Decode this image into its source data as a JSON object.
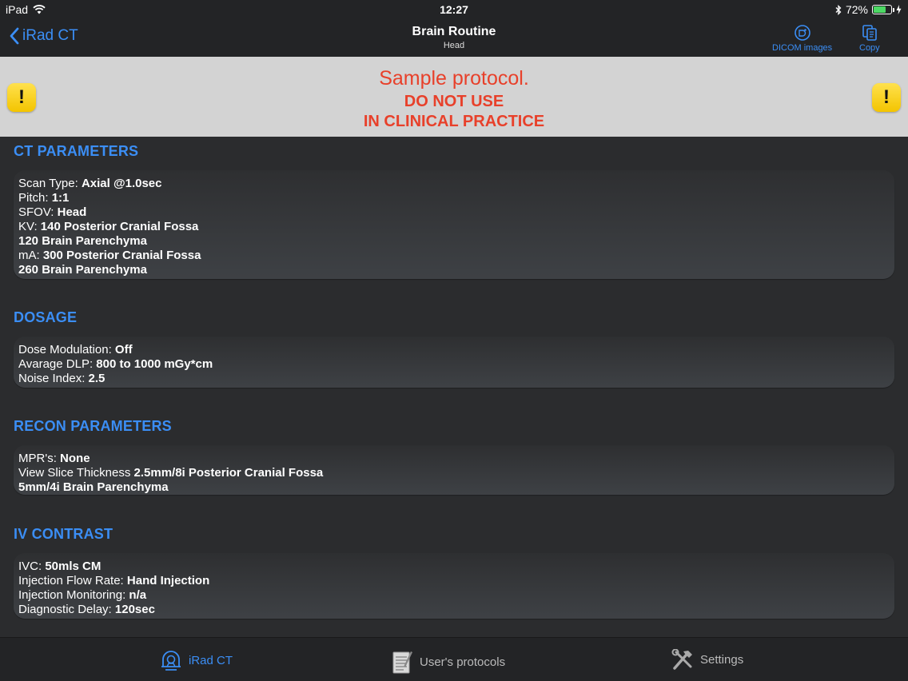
{
  "status": {
    "device": "iPad",
    "time": "12:27",
    "battery": "72%",
    "battery_level": 0.72
  },
  "nav": {
    "back_label": "iRad CT",
    "title": "Brain Routine",
    "subtitle": "Head",
    "dicom_label": "DICOM images",
    "copy_label": "Copy"
  },
  "banner": {
    "line1": "Sample protocol.",
    "line2": "DO NOT USE",
    "line3": "IN CLINICAL PRACTICE",
    "warning_glyph": "!"
  },
  "sections": {
    "ct": {
      "title": "CT PARAMETERS",
      "lines": [
        {
          "label": "Scan Type: ",
          "value": "Axial @1.0sec"
        },
        {
          "label": "Pitch: ",
          "value": "1:1"
        },
        {
          "label": "SFOV: ",
          "value": "Head"
        },
        {
          "label": "KV: ",
          "value": "140 Posterior Cranial Fossa"
        },
        {
          "label": "",
          "value": "120 Brain Parenchyma"
        },
        {
          "label": "mA: ",
          "value": "300 Posterior Cranial Fossa"
        },
        {
          "label": "",
          "value": "260 Brain Parenchyma"
        }
      ]
    },
    "dosage": {
      "title": "DOSAGE",
      "lines": [
        {
          "label": "Dose Modulation: ",
          "value": "Off"
        },
        {
          "label": "Avarage DLP: ",
          "value": "800 to 1000 mGy*cm"
        },
        {
          "label": "Noise Index: ",
          "value": "2.5"
        }
      ]
    },
    "recon": {
      "title": "RECON PARAMETERS",
      "lines": [
        {
          "label": "MPR's: ",
          "value": "None"
        },
        {
          "label": "View Slice Thickness ",
          "value": "2.5mm/8i Posterior Cranial Fossa"
        },
        {
          "label": "",
          "value": "5mm/4i Brain Parenchyma"
        }
      ]
    },
    "iv": {
      "title": "IV CONTRAST",
      "lines": [
        {
          "label": "IVC: ",
          "value": "50mls CM"
        },
        {
          "label": "Injection Flow Rate: ",
          "value": "Hand Injection"
        },
        {
          "label": "Injection Monitoring: ",
          "value": "n/a"
        },
        {
          "label": "Diagnostic Delay: ",
          "value": "120sec"
        }
      ]
    }
  },
  "tabs": {
    "irad": "iRad CT",
    "protocols": "User's protocols",
    "settings": "Settings"
  },
  "colors": {
    "accent": "#3b8ef5",
    "warning_text": "#e8402a",
    "banner_bg": "#d3d3d3"
  }
}
